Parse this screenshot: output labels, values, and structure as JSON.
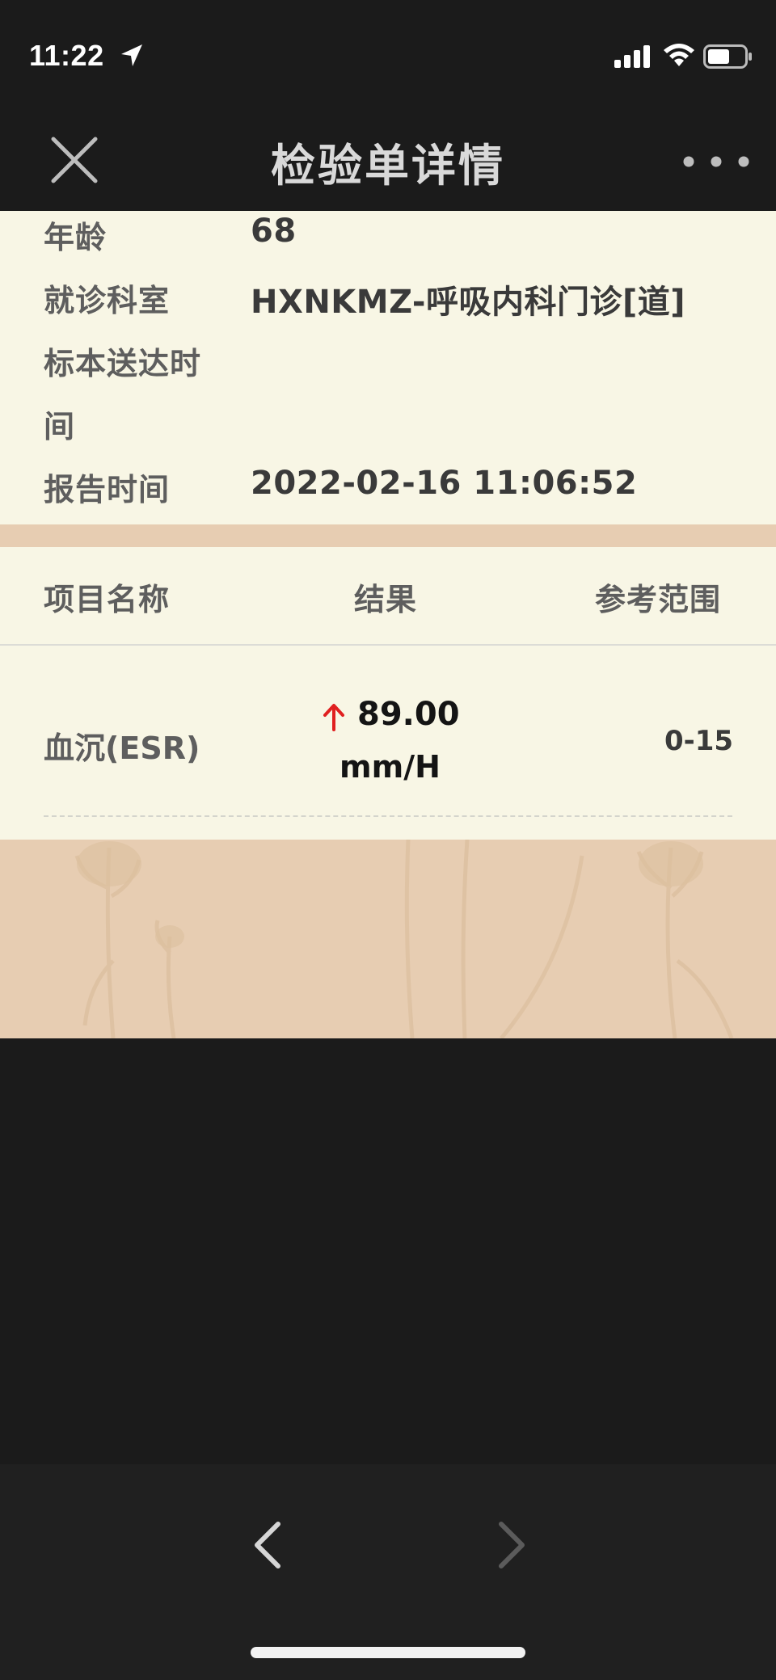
{
  "status_bar": {
    "time": "11:22",
    "icons": [
      "location-arrow-icon",
      "cellular-signal-icon",
      "wifi-icon",
      "battery-icon"
    ]
  },
  "nav": {
    "title": "检验单详情",
    "close_icon": "close-icon",
    "more_icon": "more-dots-icon"
  },
  "info": {
    "rows": [
      {
        "label": "年龄",
        "value": "68"
      },
      {
        "label": "就诊科室",
        "value": "HXNKMZ-呼吸内科门诊[道]"
      },
      {
        "label_line1": "标本送达时",
        "label_line2": "间",
        "value": ""
      },
      {
        "label": "报告时间",
        "value": "2022-02-16  11:06:52"
      }
    ]
  },
  "table": {
    "headers": [
      "项目名称",
      "结果",
      "参考范围"
    ],
    "rows": [
      {
        "name": "血沉(ESR)",
        "result": "89.00",
        "unit": "mm/H",
        "flag": "up-arrow-icon",
        "reference": "0-15"
      }
    ]
  },
  "toolbar": {
    "back_icon": "chevron-left-icon",
    "forward_icon": "chevron-right-icon"
  },
  "colors": {
    "page_bg": "#1b1b1b",
    "panel_bg": "#f8f6e5",
    "accent_bg": "#e7cdb2",
    "abnormal_flag": "#e02020"
  }
}
